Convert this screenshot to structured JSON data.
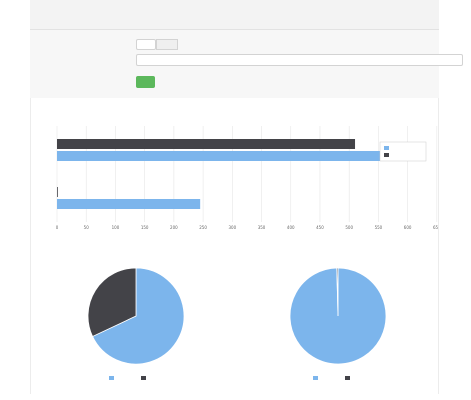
{
  "page": {
    "title": "",
    "subtitle": ""
  },
  "form": {
    "field1_label": "",
    "field1_value": "",
    "field1_unit": "",
    "field2_label": "",
    "field2_value": "",
    "submit_label": ""
  },
  "colors": {
    "blue": "#7cb5ec",
    "dark": "#434348",
    "submit": "#5cb85c"
  },
  "chart_data": [
    {
      "type": "bar",
      "orientation": "horizontal",
      "title": "",
      "categories": [
        "",
        ""
      ],
      "series": [
        {
          "values": [
            510,
            0
          ],
          "color": "#434348",
          "data_labels": [
            "",
            ""
          ]
        },
        {
          "values": [
            600,
            245
          ],
          "color": "#7cb5ec",
          "data_labels": [
            "",
            ""
          ]
        }
      ],
      "legend_entries": [
        "",
        ""
      ],
      "legend_position": "right",
      "xlabel": "",
      "xlim": [
        0,
        640
      ],
      "xticks": [
        0,
        50,
        100,
        150,
        200,
        250,
        300,
        350,
        400,
        450,
        500,
        550,
        600,
        650
      ],
      "grid": true
    },
    {
      "type": "pie",
      "title": "",
      "slices": [
        {
          "value": 68,
          "color": "#7cb5ec"
        },
        {
          "value": 32,
          "color": "#434348"
        }
      ],
      "legend_entries": [
        "",
        ""
      ],
      "legend_position": "bottom",
      "credits": ""
    },
    {
      "type": "pie",
      "title": "",
      "slices": [
        {
          "value": 99.6,
          "color": "#7cb5ec"
        },
        {
          "value": 0.4,
          "color": "#434348"
        }
      ],
      "legend_entries": [
        "",
        ""
      ],
      "legend_position": "bottom",
      "credits": ""
    }
  ]
}
